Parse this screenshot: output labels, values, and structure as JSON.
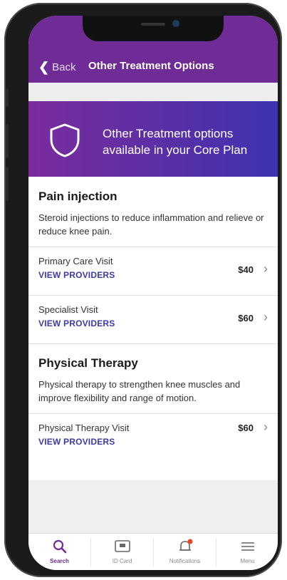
{
  "header": {
    "back_label": "Back",
    "title": "Other Treatment Options"
  },
  "banner": {
    "text": "Other Treatment options available in your Core Plan",
    "icon": "shield-icon"
  },
  "sections": [
    {
      "title": "Pain injection",
      "description": "Steroid injections to reduce inflammation and relieve or reduce knee pain.",
      "rows": [
        {
          "label": "Primary Care Visit",
          "link": "VIEW PROVIDERS",
          "price": "$40"
        },
        {
          "label": "Specialist Visit",
          "link": "VIEW PROVIDERS",
          "price": "$60"
        }
      ]
    },
    {
      "title": "Physical Therapy",
      "description": "Physical therapy to strengthen knee muscles and improve flexibility and range of motion.",
      "rows": [
        {
          "label": "Physical Therapy Visit",
          "link": "VIEW PROVIDERS",
          "price": "$60"
        }
      ]
    }
  ],
  "tabs": [
    {
      "label": "Search",
      "icon": "search-icon",
      "active": true
    },
    {
      "label": "ID Card",
      "icon": "id-card-icon",
      "active": false
    },
    {
      "label": "Notifications",
      "icon": "bell-icon",
      "active": false
    },
    {
      "label": "Menu",
      "icon": "menu-icon",
      "active": false
    }
  ],
  "colors": {
    "brand": "#6f2b96",
    "link": "#3d3aa8",
    "notification_dot": "#e8452c"
  }
}
